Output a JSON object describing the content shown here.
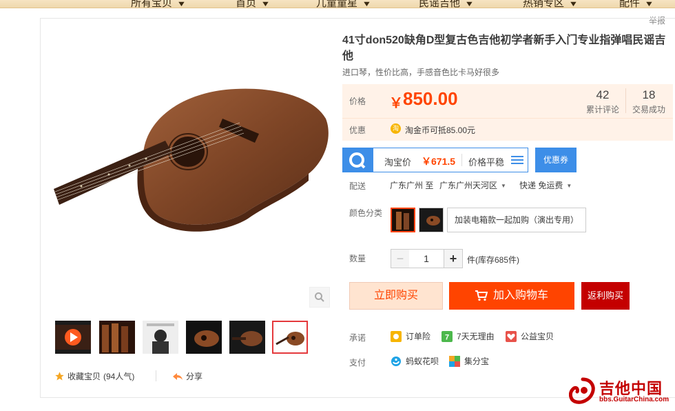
{
  "nav": {
    "items": [
      "所有宝贝",
      "首页",
      "儿童童星",
      "民谣吉他",
      "热销专区",
      "配件"
    ]
  },
  "report_link": "举报",
  "product": {
    "title": "41寸don520缺角D型复古色吉他初学者新手入门专业指弹唱民谣吉他",
    "subtitle": "进口琴，性价比高，手感音色比卡马好很多"
  },
  "price": {
    "label": "价格",
    "currency": "￥",
    "value": "850.00",
    "reviews_count": "42",
    "reviews_label": "累计评论",
    "sales_count": "18",
    "sales_label": "交易成功",
    "discount_label": "优惠",
    "discount_icon": "淘",
    "discount_text": "淘金币可抵85.00元"
  },
  "taobao_price": {
    "label": "淘宝价",
    "value": "￥671.5",
    "trend": "价格平稳",
    "coupon_button": "优惠券"
  },
  "shipping": {
    "label": "配送",
    "from": "广东广州 至",
    "to": "广东广州天河区",
    "method": "快递 免运费"
  },
  "sku": {
    "label": "颜色分类",
    "option_text": "加装电箱款一起加购（演出专用）"
  },
  "quantity": {
    "label": "数量",
    "minus": "−",
    "value": "1",
    "plus": "+",
    "stock": "件(库存685件)"
  },
  "actions": {
    "buy_now": "立即购买",
    "add_to_cart": "加入购物车",
    "rebate": "返利购买"
  },
  "promise": {
    "label": "承诺",
    "items": [
      "订单险",
      "7天无理由",
      "公益宝贝"
    ]
  },
  "payment": {
    "label": "支付",
    "items": [
      "蚂蚁花呗",
      "集分宝"
    ]
  },
  "gallery": {
    "favorite_label": "收藏宝贝",
    "favorite_count": "(94人气)",
    "share_label": "分享"
  },
  "watermark": {
    "title": "吉他中国",
    "url": "bbs.GuitarChina.com"
  },
  "colors": {
    "accent": "#ff4400",
    "price_bg": "#fff2e8",
    "tb_blue": "#3d8ee8",
    "rebate_red": "#c40000"
  }
}
